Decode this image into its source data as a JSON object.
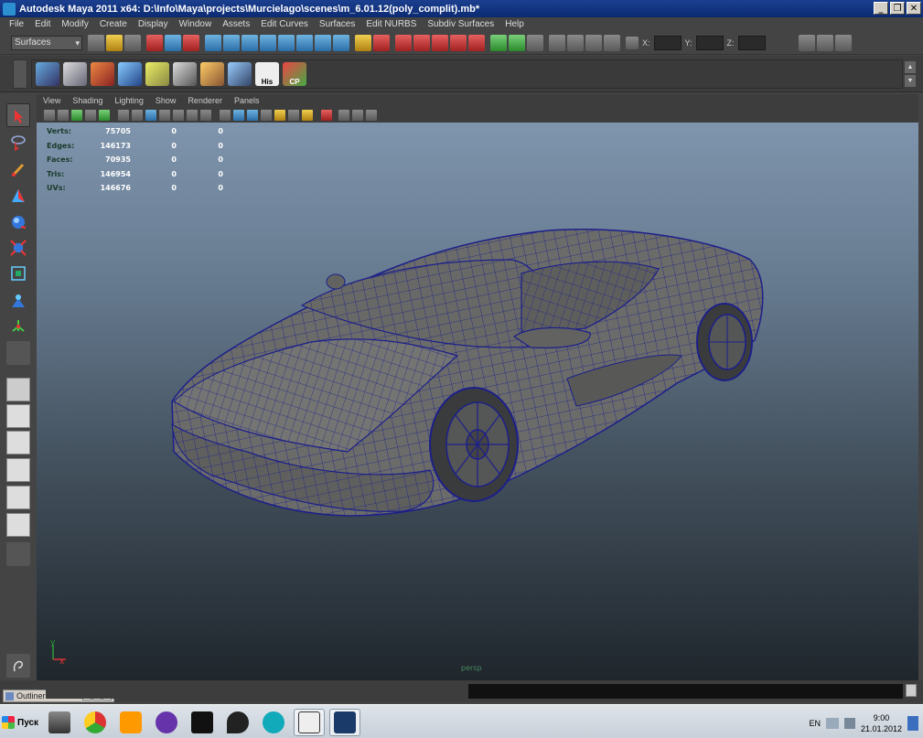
{
  "window": {
    "title": "Autodesk Maya 2011 x64: D:\\Info\\Maya\\projects\\Murcielago\\scenes\\m_6.01.12(poly_complit).mb*",
    "minimize": "_",
    "restore": "❐",
    "close": "✕"
  },
  "menu": [
    "File",
    "Edit",
    "Modify",
    "Create",
    "Display",
    "Window",
    "Assets",
    "Edit Curves",
    "Surfaces",
    "Edit NURBS",
    "Subdiv Surfaces",
    "Help"
  ],
  "status": {
    "mode": "Surfaces",
    "x_label": "X:",
    "y_label": "Y:",
    "z_label": "Z:"
  },
  "shelf": {
    "his_label": "His",
    "cp_label": "CP",
    "scroll_up": "▲",
    "scroll_down": "▼"
  },
  "panel_menu": [
    "View",
    "Shading",
    "Lighting",
    "Show",
    "Renderer",
    "Panels"
  ],
  "hud": [
    {
      "label": "Verts:",
      "v1": "75705",
      "v2": "0",
      "v3": "0"
    },
    {
      "label": "Edges:",
      "v1": "146173",
      "v2": "0",
      "v3": "0"
    },
    {
      "label": "Faces:",
      "v1": "70935",
      "v2": "0",
      "v3": "0"
    },
    {
      "label": "Tris:",
      "v1": "146954",
      "v2": "0",
      "v3": "0"
    },
    {
      "label": "UVs:",
      "v1": "146676",
      "v2": "0",
      "v3": "0"
    }
  ],
  "viewport": {
    "camera": "persp",
    "axis_x": "x",
    "axis_y": "y"
  },
  "outliner": {
    "title": "Outliner"
  },
  "taskbar": {
    "start": "Пуск",
    "lang": "EN",
    "time": "9:00",
    "date": "21.01.2012"
  },
  "colors": {
    "wireframe": "#1c1f8a",
    "surface": "#6a6a68",
    "viewport_top": "#7f95ad",
    "viewport_bottom": "#1f262c"
  }
}
